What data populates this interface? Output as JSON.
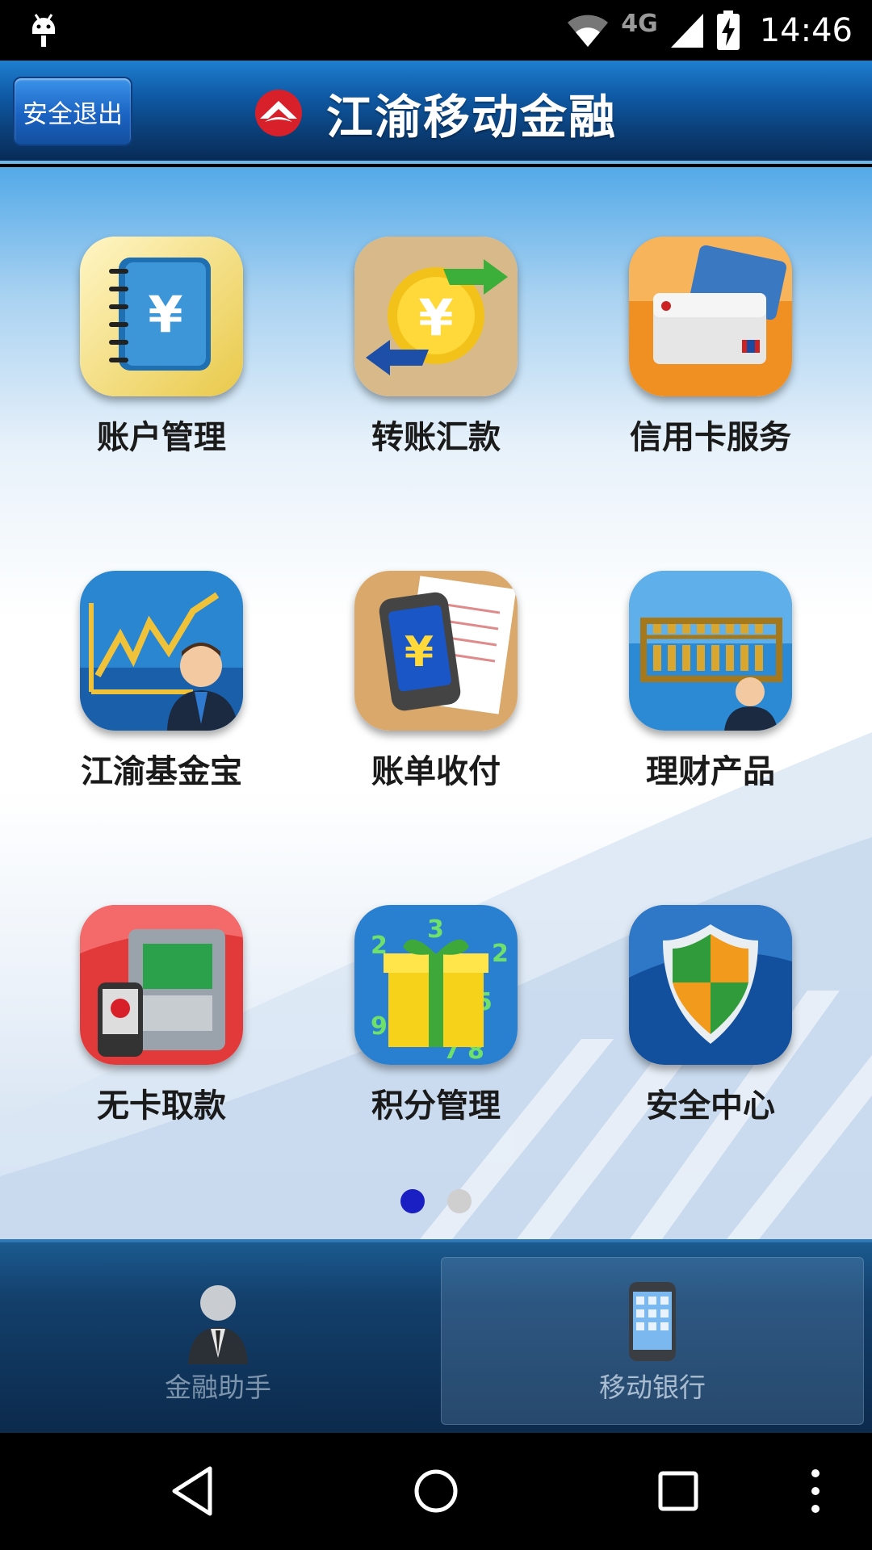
{
  "status_bar": {
    "network": "4G",
    "time": "14:46",
    "icons": [
      "android-debug-icon",
      "wifi-icon",
      "cell-signal-icon",
      "battery-charging-icon"
    ]
  },
  "header": {
    "exit_button": "安全退出",
    "title": "江渝移动金融",
    "logo_icon": "bank-logo-icon",
    "accent_color": "#0f5aa6"
  },
  "apps": [
    {
      "label": "账户管理",
      "icon": "notebook-yen-icon"
    },
    {
      "label": "转账汇款",
      "icon": "coin-transfer-icon"
    },
    {
      "label": "信用卡服务",
      "icon": "credit-card-icon"
    },
    {
      "label": "江渝基金宝",
      "icon": "fund-chart-icon"
    },
    {
      "label": "账单收付",
      "icon": "phone-bill-icon"
    },
    {
      "label": "理财产品",
      "icon": "abacus-icon"
    },
    {
      "label": "无卡取款",
      "icon": "atm-icon"
    },
    {
      "label": "积分管理",
      "icon": "gift-box-icon"
    },
    {
      "label": "安全中心",
      "icon": "shield-icon"
    }
  ],
  "pager": {
    "current": 1,
    "total": 2
  },
  "tabs": [
    {
      "label": "金融助手",
      "icon": "assistant-person-icon",
      "active": false
    },
    {
      "label": "移动银行",
      "icon": "mobile-phone-icon",
      "active": true
    }
  ],
  "nav": [
    "back-icon",
    "home-icon",
    "recents-icon",
    "more-icon"
  ]
}
